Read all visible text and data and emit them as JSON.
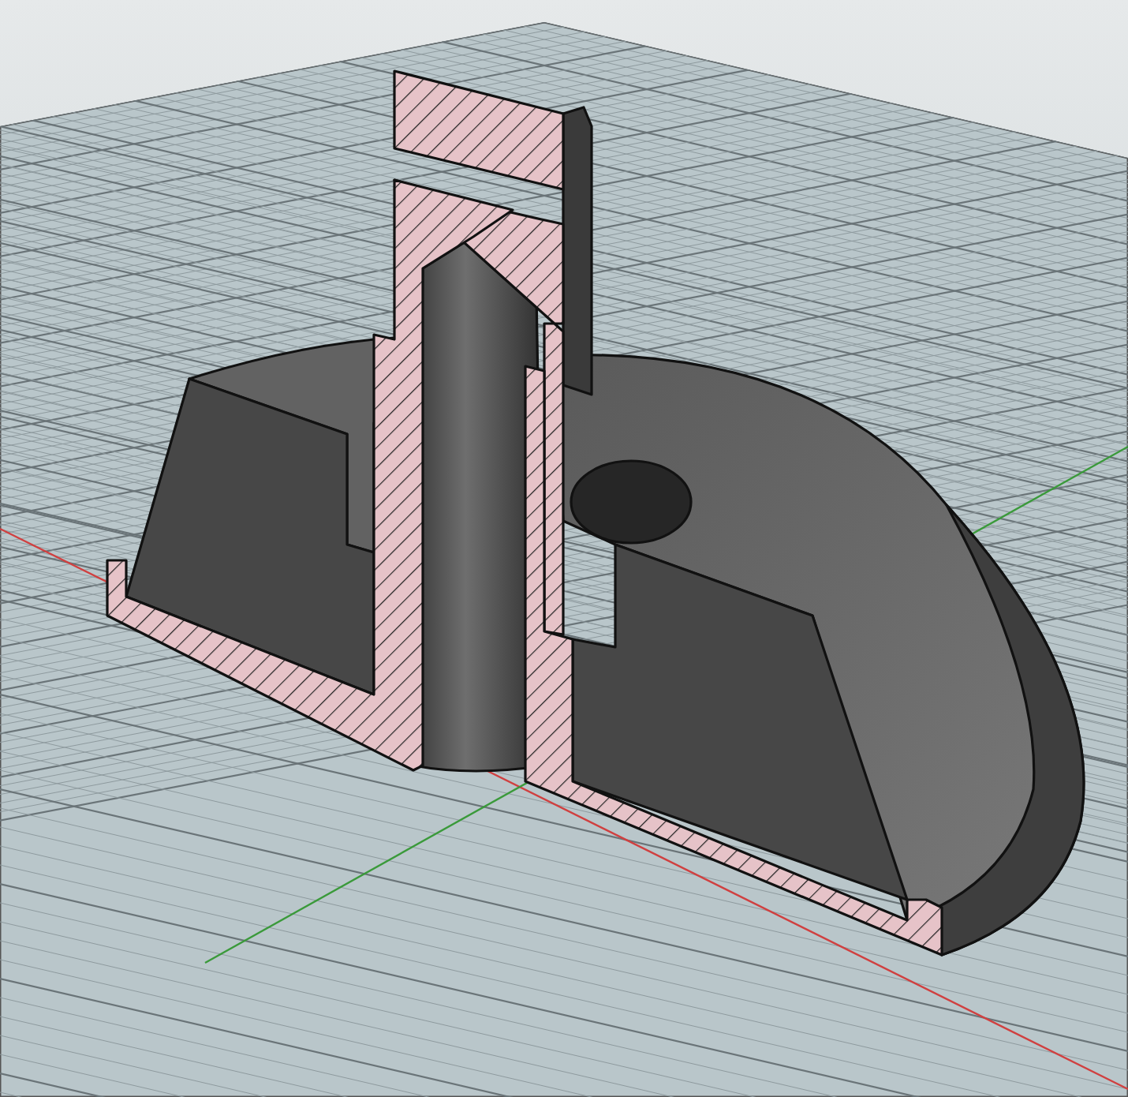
{
  "viewport": {
    "grid_visible": true,
    "axes_visible": true,
    "section_hatch": true
  }
}
